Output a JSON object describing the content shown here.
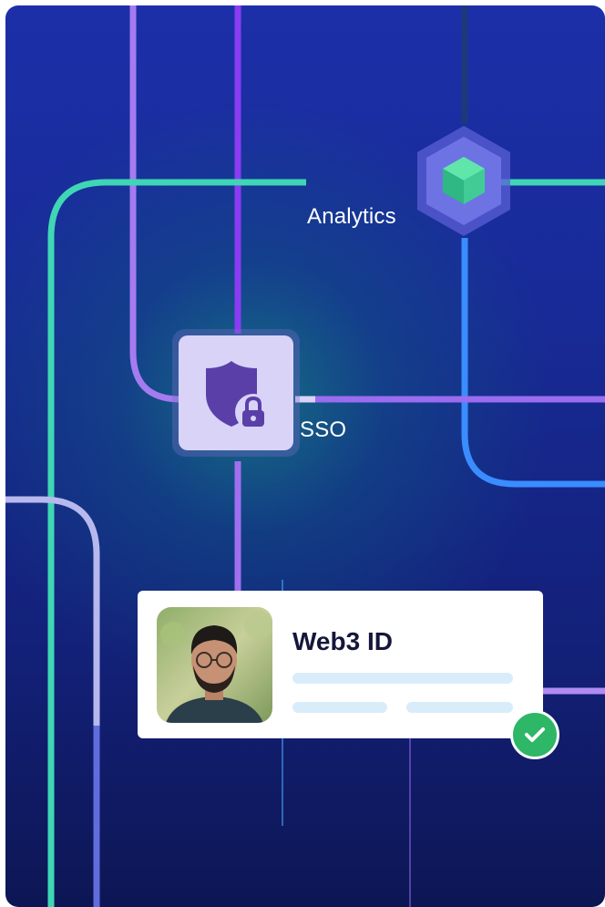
{
  "nodes": {
    "analytics_label": "Analytics",
    "sso_label": "SSO"
  },
  "card": {
    "title": "Web3 ID"
  },
  "icons": {
    "shield": "shield-lock-icon",
    "analytics": "cube-hexagon-icon",
    "check": "check-icon",
    "avatar": "user-avatar"
  },
  "colors": {
    "background": "#1b2c9e",
    "teal_line": "#3fd6b5",
    "purple_line": "#9a6cf0",
    "blue_line": "#3a8dff",
    "light_line": "#b7b9ee",
    "check": "#2eb766",
    "card_title": "#15163a"
  }
}
